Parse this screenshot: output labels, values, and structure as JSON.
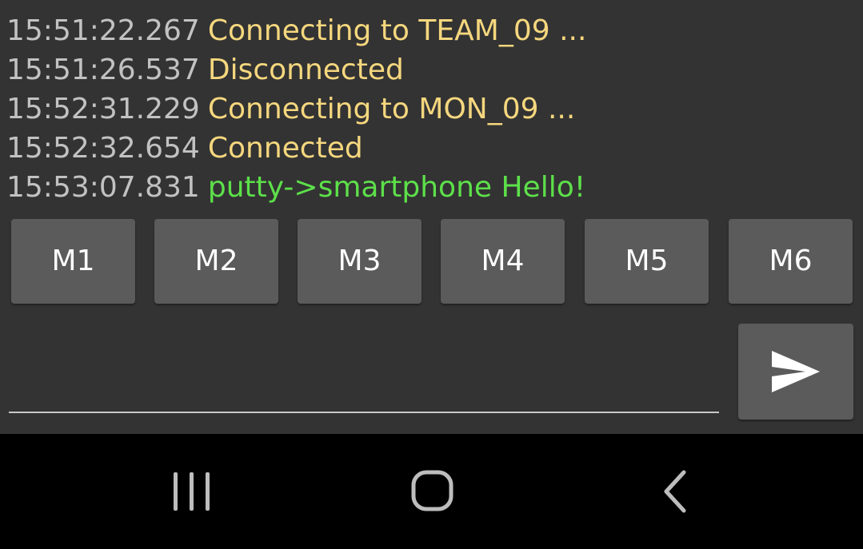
{
  "log": [
    {
      "time": "15:51:22.267",
      "text": "Connecting to TEAM_09 ...",
      "color": "#f5d77e"
    },
    {
      "time": "15:51:26.537",
      "text": "Disconnected",
      "color": "#f5d77e"
    },
    {
      "time": "15:52:31.229",
      "text": "Connecting to MON_09 ...",
      "color": "#f5d77e"
    },
    {
      "time": "15:52:32.654",
      "text": "Connected",
      "color": "#f5d77e"
    },
    {
      "time": "15:53:07.831",
      "text": "putty->smartphone Hello!",
      "color": "#5de04a"
    }
  ],
  "macros": [
    "M1",
    "M2",
    "M3",
    "M4",
    "M5",
    "M6"
  ],
  "input": {
    "value": "",
    "placeholder": ""
  },
  "send": {
    "icon": "send-icon"
  },
  "navbar": {
    "recent": {
      "icon": "recent-apps-icon"
    },
    "home": {
      "icon": "home-icon"
    },
    "back": {
      "icon": "back-icon"
    }
  },
  "colors": {
    "background": "#333333",
    "timestamp": "#c2c2c2",
    "status": "#f5d77e",
    "received": "#5de04a",
    "button": "#5b5b5b"
  }
}
